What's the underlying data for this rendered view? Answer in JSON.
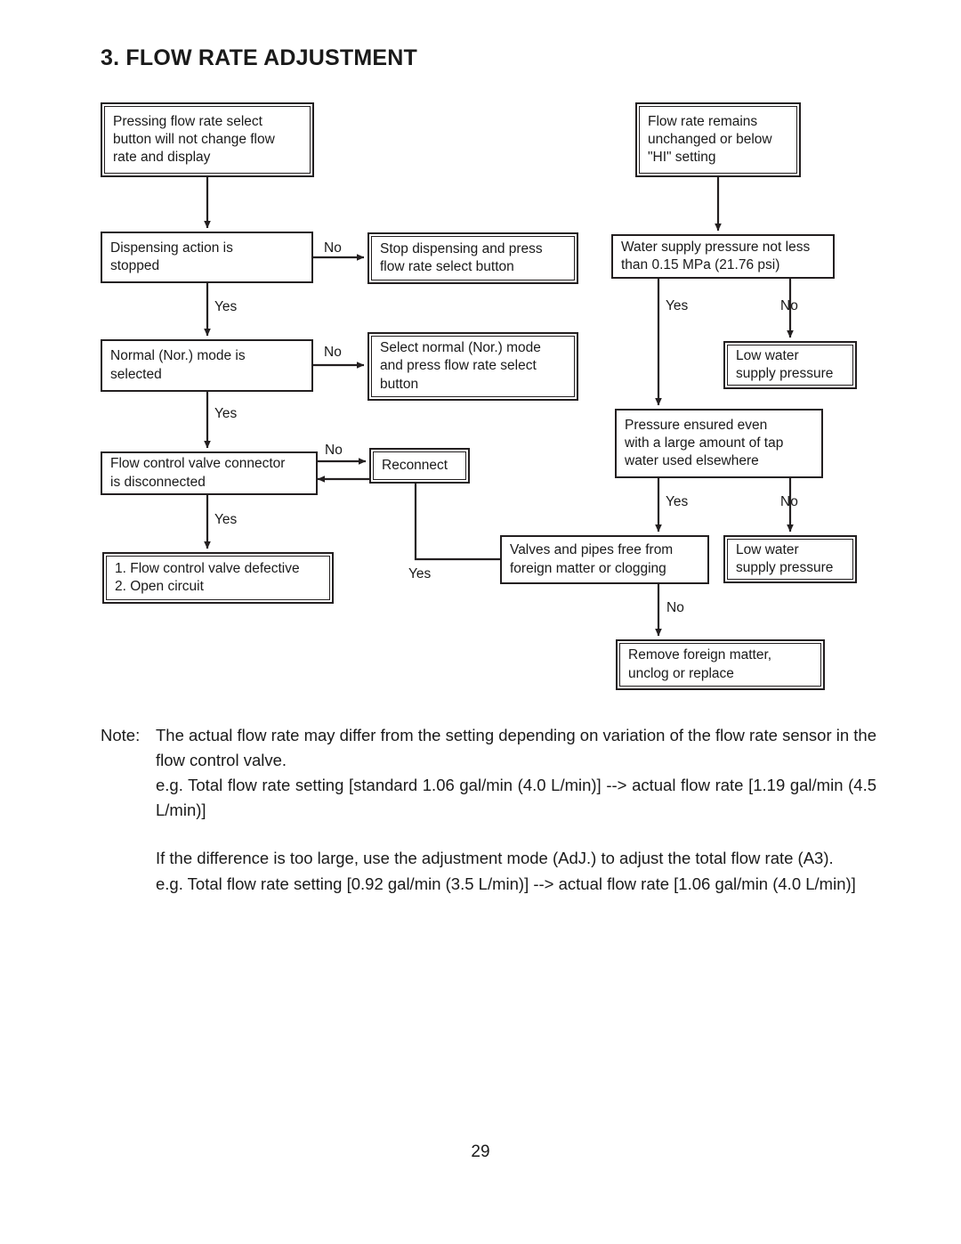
{
  "document": {
    "section_title": "3. FLOW RATE ADJUSTMENT",
    "page_number": "29"
  },
  "flowchart": {
    "nodes": {
      "pressing_select_button": "Pressing flow rate select\nbutton will not change flow\nrate and display",
      "dispensing_stopped": "Dispensing action is\nstopped",
      "stop_dispensing": "Stop dispensing and press\nflow rate select button",
      "normal_mode_selected": "Normal (Nor.) mode is\nselected",
      "select_normal_mode": "Select normal (Nor.) mode\nand press flow rate select\nbutton",
      "connector_disconnected": "Flow control valve connector\nis disconnected",
      "reconnect": "Reconnect",
      "valve_defective": "1. Flow control valve defective\n2. Open circuit",
      "flow_rate_remains": "Flow rate remains\nunchanged or below\n\"HI\" setting",
      "water_supply_pressure": "Water supply pressure not less\nthan 0.15 MPa (21.76 psi)",
      "low_water_pressure_1": "Low water\nsupply pressure",
      "pressure_ensured": "Pressure ensured even\nwith a large amount of tap\nwater used elsewhere",
      "valves_pipes_free": "Valves and pipes free from\nforeign matter or clogging",
      "low_water_pressure_2": "Low water\nsupply pressure",
      "remove_foreign_matter": "Remove foreign matter,\nunclog or replace"
    },
    "edge_labels": {
      "dispensing_no": "No",
      "dispensing_yes": "Yes",
      "normal_mode_no": "No",
      "normal_mode_yes": "Yes",
      "connector_no": "No",
      "connector_yes": "Yes",
      "supply_pressure_yes": "Yes",
      "supply_pressure_no": "No",
      "pressure_ensured_yes": "Yes",
      "pressure_ensured_no": "No",
      "valves_yes": "Yes",
      "valves_no": "No"
    }
  },
  "notes": {
    "label": "Note:",
    "paragraph_1": "The actual flow rate may differ from the setting depending on variation of the flow rate sensor in the flow control valve.",
    "paragraph_2": "e.g. Total flow rate setting [standard 1.06 gal/min (4.0 L/min)] --> actual flow rate [1.19 gal/min (4.5 L/min)]",
    "paragraph_3": "If the difference is too large, use the adjustment mode (AdJ.) to adjust the total flow rate (A3).",
    "paragraph_4": "e.g. Total flow rate setting [0.92 gal/min (3.5 L/min)] --> actual flow rate [1.06 gal/min (4.0 L/min)]"
  }
}
